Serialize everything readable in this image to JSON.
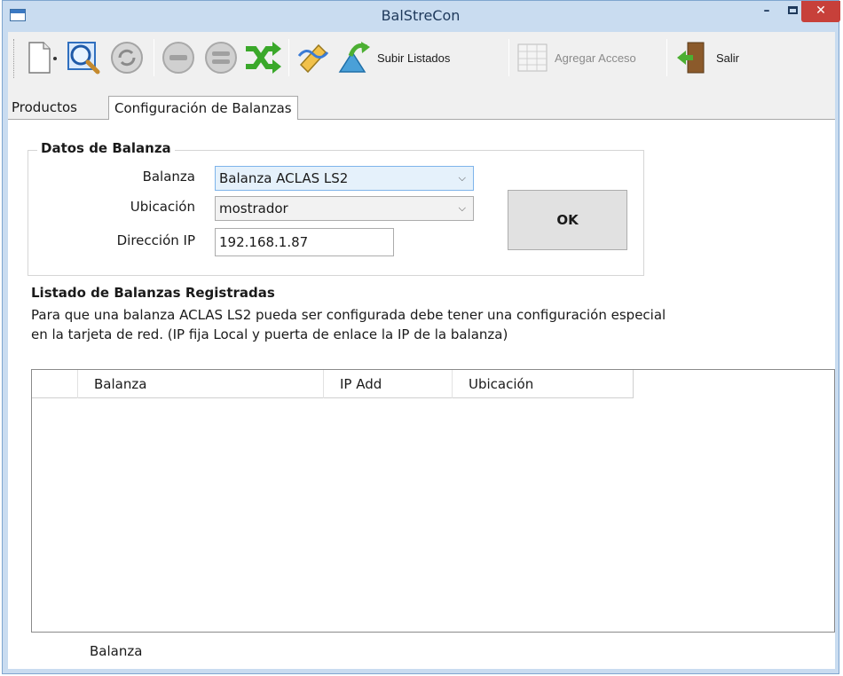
{
  "window": {
    "title": "BalStreCon",
    "accent": "#c7403a",
    "frame_color": "#c9dcf0"
  },
  "toolbar": {
    "items": [
      {
        "icon": "new-document-icon",
        "has_dropdown": true
      },
      {
        "icon": "magnifier-icon"
      },
      {
        "icon": "refresh-icon"
      },
      {
        "icon": "minus-circle-icon"
      },
      {
        "icon": "equals-circle-icon"
      },
      {
        "icon": "shuffle-icon"
      },
      {
        "icon": "edit-icon"
      },
      {
        "icon": "upload-arrow-icon",
        "label": "Subir Listados"
      },
      {
        "icon": "grid-icon",
        "label": "Agregar Acceso",
        "disabled": true
      },
      {
        "icon": "exit-door-icon",
        "label": "Salir"
      }
    ]
  },
  "tabs": [
    {
      "label": "Productos",
      "active": false
    },
    {
      "label": "Configuración de Balanzas",
      "active": true
    }
  ],
  "datos_balanza": {
    "group_title": "Datos de Balanza",
    "balanza_label": "Balanza",
    "balanza_value": "Balanza ACLAS LS2",
    "ubicacion_label": "Ubicación",
    "ubicacion_value": "mostrador",
    "ip_label": "Dirección IP",
    "ip_value": "192.168.1.87",
    "ok_label": "OK"
  },
  "listado": {
    "title": "Listado de Balanzas Registradas",
    "description_line1": "Para que una balanza ACLAS LS2 pueda ser configurada debe tener una configuración especial",
    "description_line2": "en la tarjeta de red. (IP fija Local y puerta de enlace la IP de la balanza)",
    "columns": [
      "Balanza",
      "IP Add",
      "Ubicación"
    ],
    "rows": []
  },
  "footer": {
    "label": "Balanza"
  }
}
